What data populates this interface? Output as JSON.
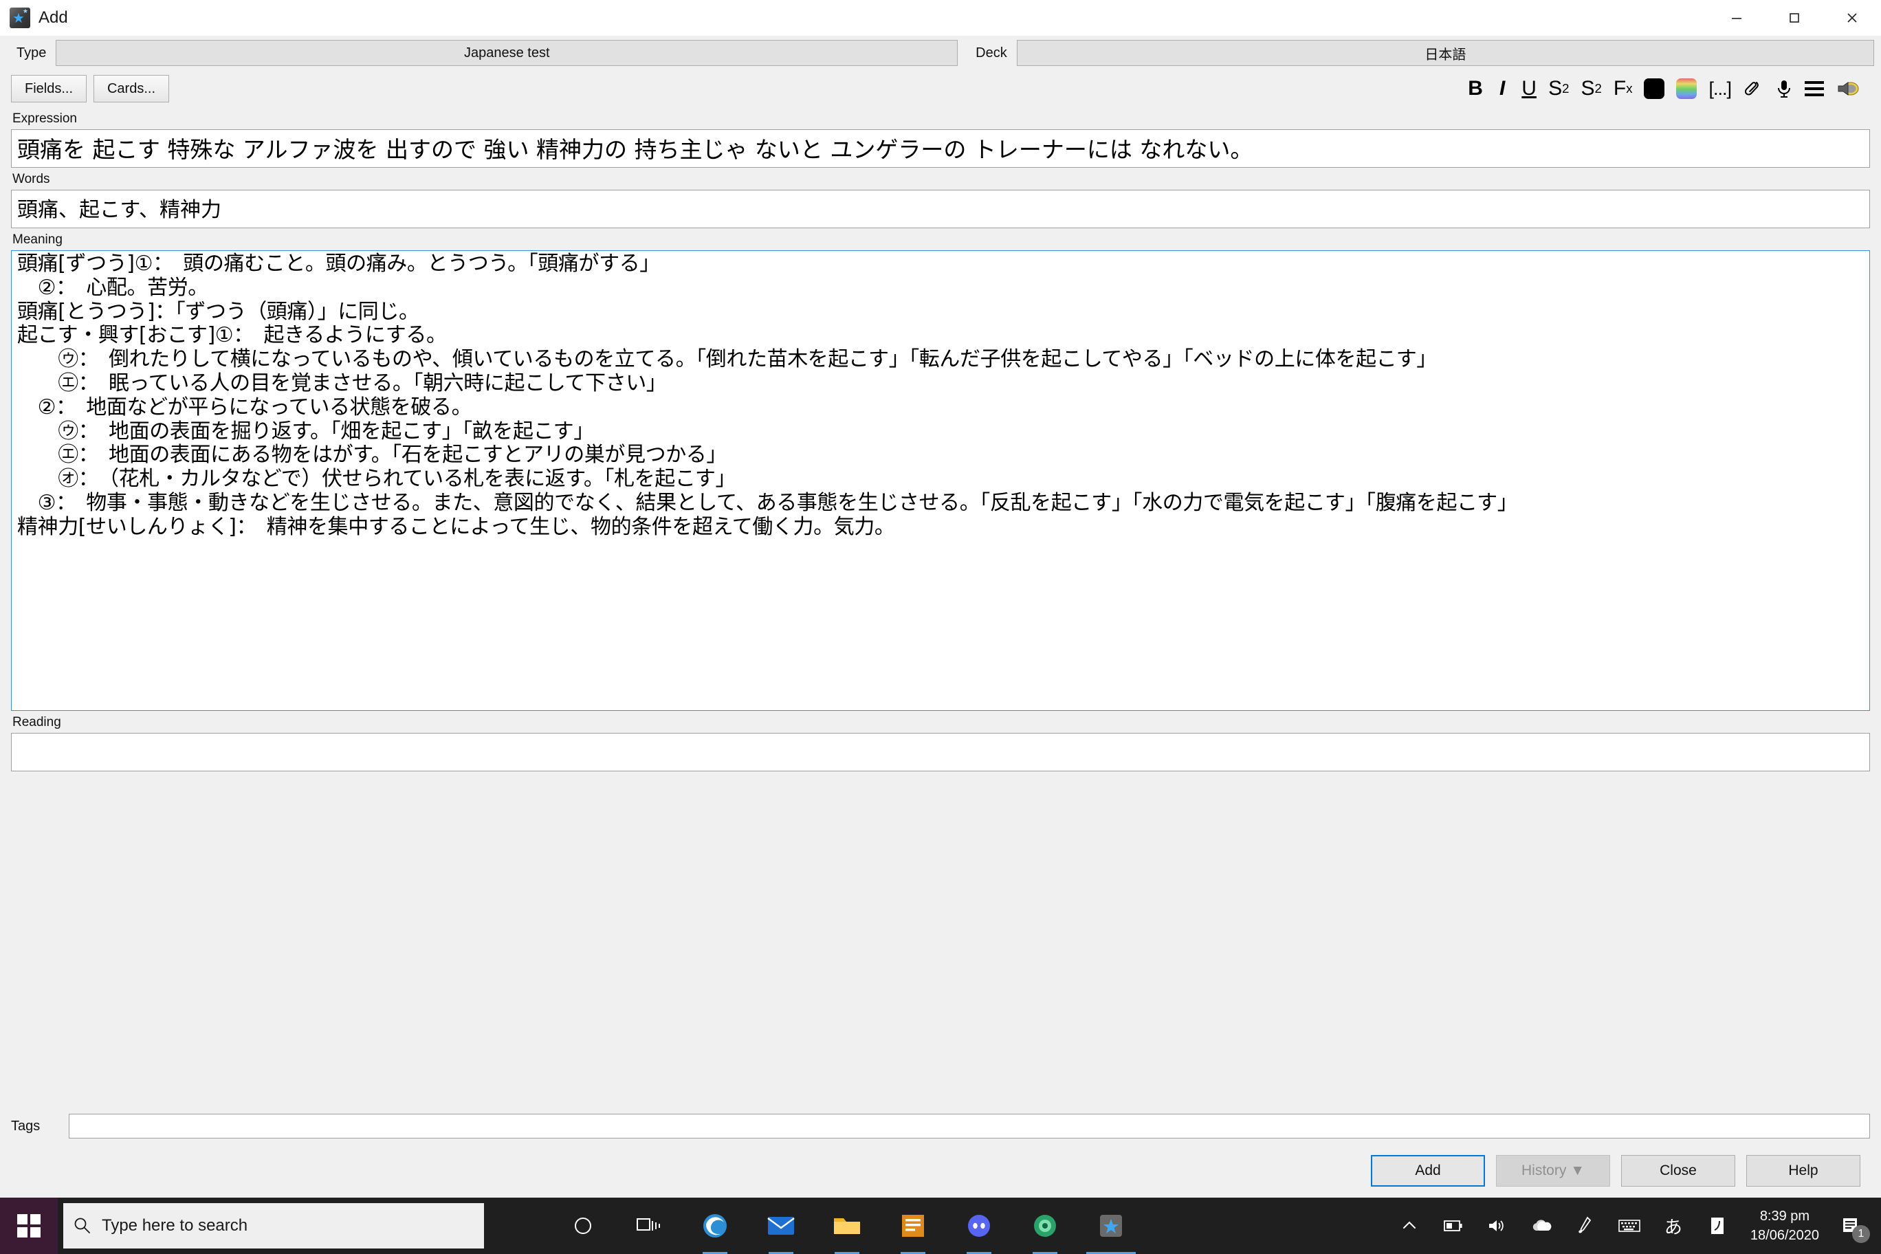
{
  "window": {
    "title": "Add",
    "icon": "anki-star-icon",
    "minimize_glyph": "─",
    "maximize_glyph": "☐",
    "close_glyph": "✕"
  },
  "toprow": {
    "type_label": "Type",
    "type_value": "Japanese test",
    "deck_label": "Deck",
    "deck_value": "日本語"
  },
  "toolbar": {
    "fields_label": "Fields...",
    "cards_label": "Cards...",
    "icons": [
      {
        "name": "bold-icon",
        "glyph": "B"
      },
      {
        "name": "italic-icon",
        "glyph": "I"
      },
      {
        "name": "underline-icon",
        "glyph": "U"
      },
      {
        "name": "superscript-icon",
        "glyph": "S"
      },
      {
        "name": "subscript-icon",
        "glyph": "S"
      },
      {
        "name": "clear-formatting-icon",
        "glyph": "F"
      },
      {
        "name": "text-color-icon",
        "glyph": "",
        "color": "#000000"
      },
      {
        "name": "highlight-color-icon",
        "glyph": ""
      },
      {
        "name": "cloze-deletion-icon",
        "glyph": "[...]"
      },
      {
        "name": "attach-media-icon",
        "glyph": "📎"
      },
      {
        "name": "record-audio-icon",
        "glyph": "🎙"
      },
      {
        "name": "mathjax-menu-icon",
        "glyph": "☰"
      },
      {
        "name": "play-sound-icon",
        "glyph": "🔊"
      }
    ],
    "superscript_sup": "2",
    "subscript_sub": "2",
    "clearfmt_sub": "x"
  },
  "fields": [
    {
      "name": "Expression",
      "value": "頭痛を 起こす 特殊な アルファ波を 出すので 強い 精神力の 持ち主じゃ ないと ユンゲラーの トレーナーには なれない。",
      "focused": false
    },
    {
      "name": "Words",
      "value": "頭痛、起こす、精神力",
      "focused": false
    },
    {
      "name": "Meaning",
      "value": "頭痛[ずつう]①：　頭の痛むこと。頭の痛み。とうつう。「頭痛がする」\n　②：　心配。苦労。\n頭痛[とうつう]：「ずつう（頭痛）」に同じ。\n起こす・興す[おこす]①：　起きるようにする。\n　　㋒：　倒れたりして横になっているものや、傾いているものを立てる。「倒れた苗木を起こす」「転んだ子供を起こしてやる」「ベッドの上に体を起こす」\n　　㋓：　眠っている人の目を覚まさせる。「朝六時に起こして下さい」\n　②：　地面などが平らになっている状態を破る。\n　　㋒：　地面の表面を掘り返す。「畑を起こす」「畝を起こす」\n　　㋓：　地面の表面にある物をはがす。「石を起こすとアリの巣が見つかる」\n　　㋔：　（花札・カルタなどで）伏せられている札を表に返す。「札を起こす」\n　③：　物事・事態・動きなどを生じさせる。また、意図的でなく、結果として、ある事態を生じさせる。「反乱を起こす」「水の力で電気を起こす」「腹痛を起こす」\n精神力[せいしんりょく]：　精神を集中することによって生じ、物的条件を超えて働く力。気力。",
      "focused": true
    },
    {
      "name": "Reading",
      "value": "",
      "focused": false
    }
  ],
  "tags": {
    "label": "Tags",
    "value": "",
    "placeholder": ""
  },
  "buttons": {
    "add": "Add",
    "history": "History ▼",
    "close": "Close",
    "help": "Help"
  },
  "taskbar": {
    "start_name": "start-button",
    "search_placeholder": "Type here to search",
    "search_icon": "search-icon",
    "apps": [
      {
        "name": "cortana-icon",
        "glyph": "○",
        "color": "",
        "kind": "glyph"
      },
      {
        "name": "task-view-icon",
        "glyph": "⌸",
        "color": "",
        "kind": "glyph"
      },
      {
        "name": "microsoft-edge-icon",
        "glyph": "e",
        "color": "#2c8fd6",
        "kind": "app",
        "running": true
      },
      {
        "name": "mail-icon",
        "glyph": "✉",
        "color": "#1f6fd0",
        "kind": "app",
        "running": true
      },
      {
        "name": "file-explorer-icon",
        "glyph": "🗀",
        "color": "#f0b429",
        "kind": "app",
        "running": true
      },
      {
        "name": "sticky-notes-icon",
        "glyph": "✎",
        "color": "#e08a1e",
        "kind": "app",
        "running": true
      },
      {
        "name": "discord-icon",
        "glyph": "◕",
        "color": "#5865f2",
        "kind": "app",
        "running": true
      },
      {
        "name": "firefox-icon",
        "glyph": "◉",
        "color": "#2aa36b",
        "kind": "app",
        "running": true
      },
      {
        "name": "anki-icon",
        "glyph": "★",
        "color": "#6a6a6a",
        "kind": "app",
        "running": true,
        "active": true
      }
    ],
    "tray": [
      {
        "name": "show-hidden-icons-icon",
        "glyph": "∧"
      },
      {
        "name": "battery-icon",
        "glyph": "▣"
      },
      {
        "name": "volume-icon",
        "glyph": "🔊"
      },
      {
        "name": "onedrive-icon",
        "glyph": "☁"
      },
      {
        "name": "pen-icon",
        "glyph": "✐"
      },
      {
        "name": "touch-keyboard-icon",
        "glyph": "⌨"
      },
      {
        "name": "ime-mode-icon",
        "glyph": "あ"
      },
      {
        "name": "ime-tool-icon",
        "glyph": "☉"
      }
    ],
    "clock_time": "8:39 pm",
    "clock_date": "18/06/2020",
    "notification_icon": "action-center-icon",
    "notification_count": "1"
  },
  "colors": {
    "accent": "#0078d7",
    "focus_border": "#3f8fd1",
    "taskbar_bg": "#1f1f1f",
    "start_bg": "#3b1b33",
    "window_bg": "#f0f0f0"
  }
}
